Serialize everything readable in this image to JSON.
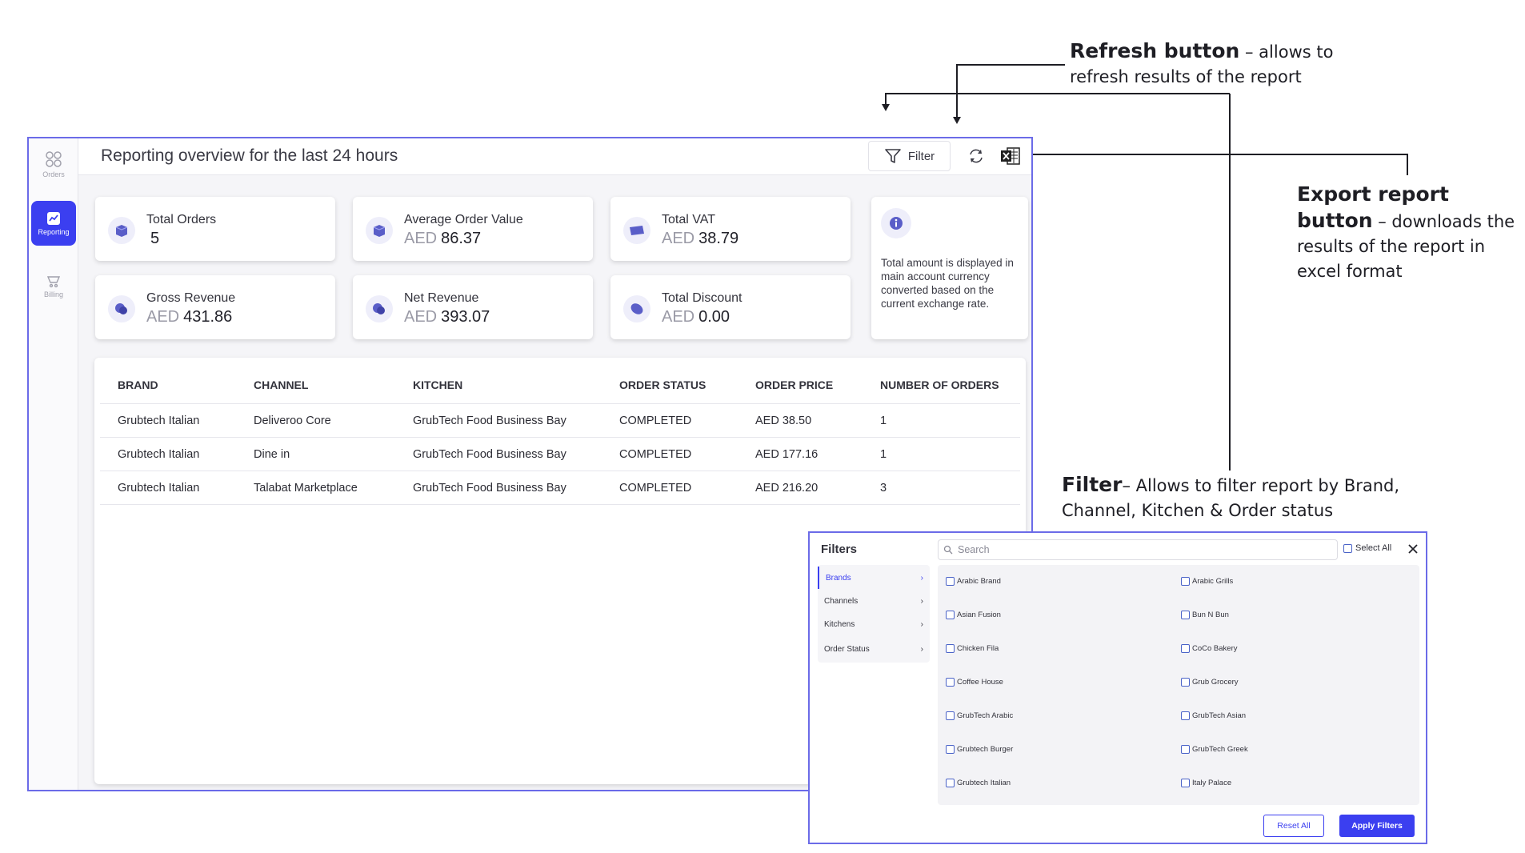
{
  "rail": {
    "orders_label": "Orders",
    "reporting_label": "Reporting",
    "billing_label": "Billing"
  },
  "header": {
    "title": "Reporting overview for the last 24 hours",
    "filter_label": "Filter"
  },
  "cards": [
    {
      "label": "Total Orders",
      "currency": "",
      "value": "5"
    },
    {
      "label": "Average Order Value",
      "currency": "AED",
      "value": "86.37"
    },
    {
      "label": "Total VAT",
      "currency": "AED",
      "value": "38.79"
    },
    {
      "label": "Gross Revenue",
      "currency": "AED",
      "value": "431.86"
    },
    {
      "label": "Net Revenue",
      "currency": "AED",
      "value": "393.07"
    },
    {
      "label": "Total Discount",
      "currency": "AED",
      "value": "0.00"
    }
  ],
  "info_note": "Total amount is displayed in main account currency converted based on the current exchange rate.",
  "table": {
    "columns": [
      "BRAND",
      "CHANNEL",
      "KITCHEN",
      "ORDER STATUS",
      "ORDER PRICE",
      "NUMBER OF ORDERS"
    ],
    "rows": [
      [
        "Grubtech Italian",
        "Deliveroo Core",
        "GrubTech Food Business Bay",
        "COMPLETED",
        "AED 38.50",
        "1"
      ],
      [
        "Grubtech Italian",
        "Dine in",
        "GrubTech Food Business Bay",
        "COMPLETED",
        "AED 177.16",
        "1"
      ],
      [
        "Grubtech Italian",
        "Talabat Marketplace",
        "GrubTech Food Business Bay",
        "COMPLETED",
        "AED 216.20",
        "3"
      ]
    ]
  },
  "filters": {
    "title": "Filters",
    "search_placeholder": "Search",
    "select_all": "Select All",
    "categories": [
      "Brands",
      "Channels",
      "Kitchens",
      "Order Status"
    ],
    "options": [
      "Arabic Brand",
      "Arabic Grills",
      "Asian Fusion",
      "Bun N Bun",
      "Chicken Fila",
      "CoCo Bakery",
      "Coffee House",
      "Grub Grocery",
      "GrubTech Arabic",
      "GrubTech Asian",
      "Grubtech Burger",
      "GrubTech Greek",
      "Grubtech Italian",
      "Italy Palace"
    ],
    "reset_label": "Reset All",
    "apply_label": "Apply Filters"
  },
  "annotations": {
    "refresh_title": "Refresh button",
    "refresh_desc_1": " – allows to",
    "refresh_desc_2": "refresh results of the report",
    "export_title_1": "Export report",
    "export_title_2": "button",
    "export_desc_1": " – downloads the",
    "export_desc_2": "results of the report in",
    "export_desc_3": "excel format",
    "filter_title": "Filter",
    "filter_desc_1": "– Allows to filter report by Brand,",
    "filter_desc_2": "Channel, Kitchen & Order status"
  },
  "colors": {
    "accent": "#3b3ff0",
    "frame": "#6b6be8"
  }
}
